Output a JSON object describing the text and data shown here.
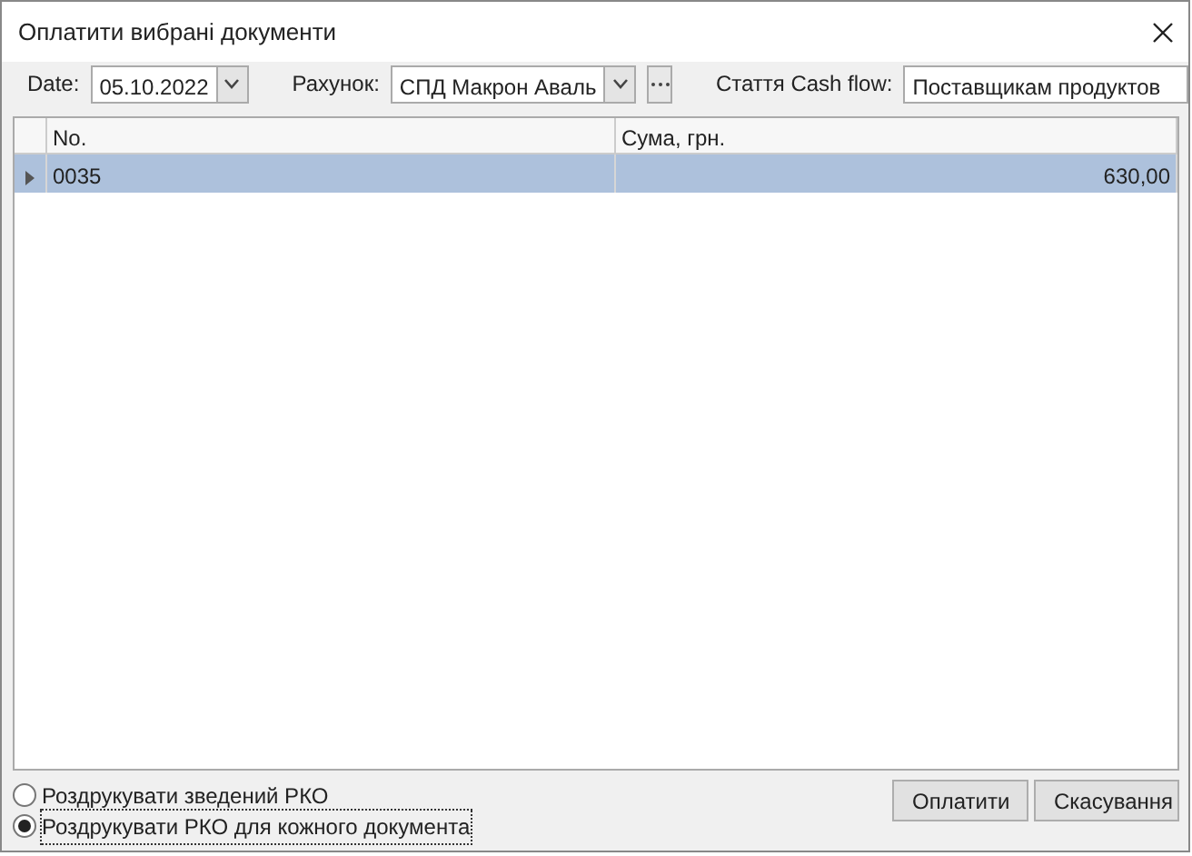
{
  "window": {
    "title": "Оплатити вибрані документи"
  },
  "filters": [
    {
      "label": "Date:",
      "value": "05.10.2022",
      "kind": "dropdown"
    },
    {
      "label": "Рахунок:",
      "value": "СПД Макрон Аваль",
      "kind": "lookup"
    },
    {
      "label": "Стаття Cash flow:",
      "value": "Поставщикам продуктов",
      "kind": "text"
    }
  ],
  "table": {
    "columns": [
      "No.",
      "Сума, грн."
    ],
    "rows": [
      {
        "cells": [
          "0035",
          "630,00"
        ],
        "selected": true
      }
    ]
  },
  "print_options": [
    {
      "label": "Роздрукувати зведений РКО",
      "selected": false
    },
    {
      "label": "Роздрукувати РКО для кожного документа",
      "selected": true
    }
  ],
  "buttons": [
    "Оплатити",
    "Скасування"
  ]
}
